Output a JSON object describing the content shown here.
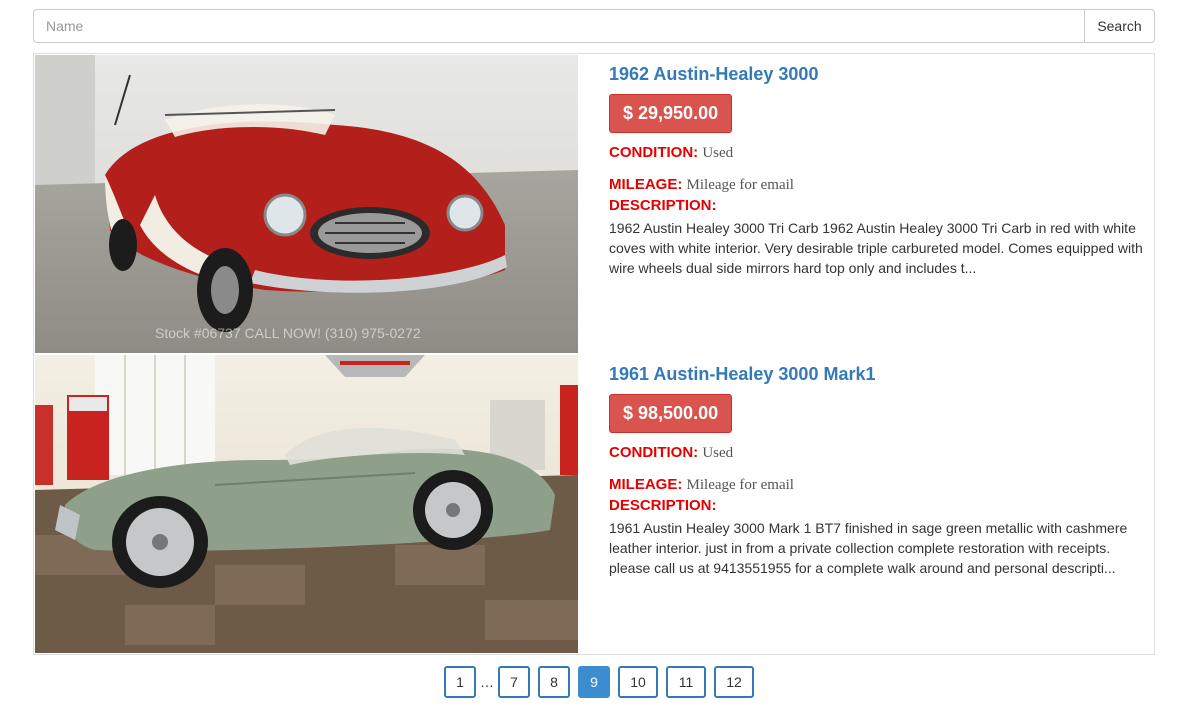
{
  "search": {
    "placeholder": "Name",
    "value": "",
    "button_label": "Search"
  },
  "listings": [
    {
      "title": "1962 Austin-Healey 3000",
      "price": "$ 29,950.00",
      "condition_label": "CONDITION:",
      "condition_value": "Used",
      "mileage_label": "MILEAGE:",
      "mileage_value": "Mileage for email",
      "description_label": "DESCRIPTION:",
      "description": "1962 Austin Healey 3000 Tri Carb 1962 Austin Healey 3000 Tri Carb in red with white coves with white interior. Very desirable triple carbureted model. Comes equipped with wire wheels dual side mirrors hard top only and includes t...",
      "image_watermark": "Stock #06737 CALL NOW! (310) 975-0272",
      "car_color": "#b3201c"
    },
    {
      "title": "1961 Austin-Healey 3000 Mark1",
      "price": "$ 98,500.00",
      "condition_label": "CONDITION:",
      "condition_value": "Used",
      "mileage_label": "MILEAGE:",
      "mileage_value": "Mileage for email",
      "description_label": "DESCRIPTION:",
      "description": "1961 Austin Healey 3000 Mark 1 BT7 finished in sage green metallic with cashmere leather interior. just in from a private collection complete restoration with receipts. please call us at 9413551955 for a complete walk around and personal descripti...",
      "car_color": "#8fa08a"
    }
  ],
  "pagination": {
    "pages": [
      "1",
      "…",
      "7",
      "8",
      "9",
      "10",
      "11",
      "12"
    ],
    "current": "9"
  },
  "colors": {
    "link": "#337ab7",
    "price_bg": "#d9534f",
    "label_red": "#e60000",
    "active_page": "#3c8dd0"
  }
}
